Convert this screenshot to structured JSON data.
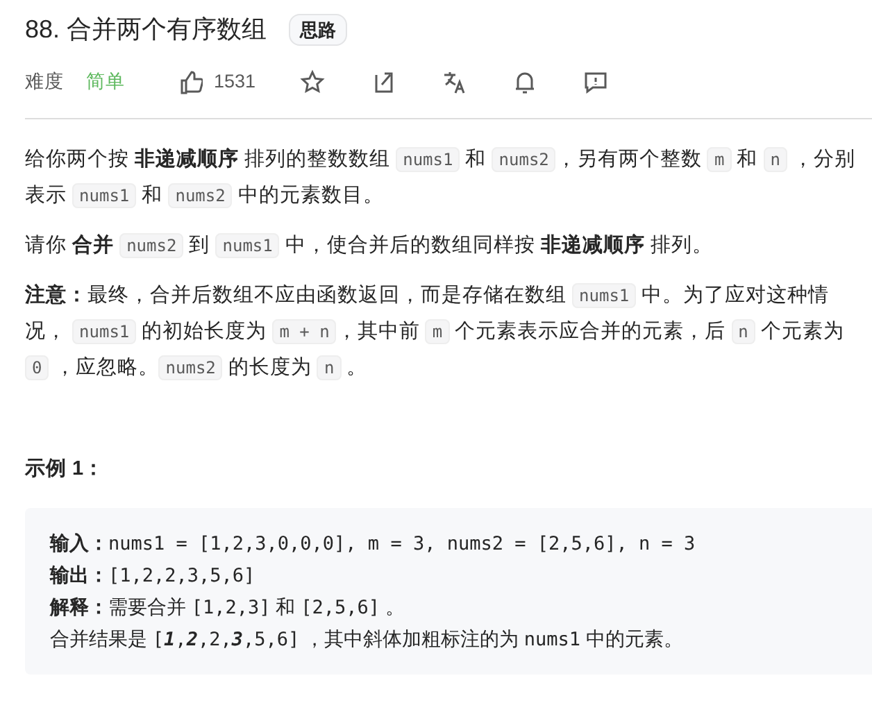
{
  "title": "88. 合并两个有序数组",
  "tag": "思路",
  "meta": {
    "difficulty_label": "难度",
    "difficulty": "简单",
    "likes": "1531"
  },
  "paragraphs": [
    [
      {
        "kind": "text",
        "text": "给你两个按 **非递减顺序** 排列的整数数组 "
      },
      {
        "kind": "code",
        "text": "nums1"
      },
      {
        "kind": "text",
        "text": " 和 "
      },
      {
        "kind": "code",
        "text": "nums2"
      },
      {
        "kind": "text",
        "text": "，另有两个整数 "
      },
      {
        "kind": "code",
        "text": "m"
      },
      {
        "kind": "text",
        "text": " 和 "
      },
      {
        "kind": "code",
        "text": "n"
      },
      {
        "kind": "text",
        "text": " ，分别表示 "
      },
      {
        "kind": "code",
        "text": "nums1"
      },
      {
        "kind": "text",
        "text": " 和 "
      },
      {
        "kind": "code",
        "text": "nums2"
      },
      {
        "kind": "text",
        "text": " 中的元素数目。"
      }
    ],
    [
      {
        "kind": "text",
        "text": "请你 **合并** "
      },
      {
        "kind": "code",
        "text": "nums2"
      },
      {
        "kind": "text",
        "text": " 到 "
      },
      {
        "kind": "code",
        "text": "nums1"
      },
      {
        "kind": "text",
        "text": " 中，使合并后的数组同样按 **非递减顺序** 排列。"
      }
    ],
    [
      {
        "kind": "text",
        "text": "**注意：**最终，合并后数组不应由函数返回，而是存储在数组 "
      },
      {
        "kind": "code",
        "text": "nums1"
      },
      {
        "kind": "text",
        "text": " 中。为了应对这种情况， "
      },
      {
        "kind": "code",
        "text": "nums1"
      },
      {
        "kind": "text",
        "text": " 的初始长度为 "
      },
      {
        "kind": "code",
        "text": "m + n"
      },
      {
        "kind": "text",
        "text": "，其中前 "
      },
      {
        "kind": "code",
        "text": "m"
      },
      {
        "kind": "text",
        "text": " 个元素表示应合并的元素，后 "
      },
      {
        "kind": "code",
        "text": "n"
      },
      {
        "kind": "text",
        "text": " 个元素为 "
      },
      {
        "kind": "code",
        "text": "0"
      },
      {
        "kind": "text",
        "text": " ，应忽略。"
      },
      {
        "kind": "code",
        "text": "nums2"
      },
      {
        "kind": "text",
        "text": " 的长度为 "
      },
      {
        "kind": "code",
        "text": "n"
      },
      {
        "kind": "text",
        "text": " 。"
      }
    ]
  ],
  "example": {
    "heading": "示例 1：",
    "lines": [
      [
        {
          "kind": "label",
          "text": "输入："
        },
        {
          "kind": "mono",
          "text": "nums1 = [1,2,3,0,0,0], m = 3, nums2 = [2,5,6], n = 3"
        }
      ],
      [
        {
          "kind": "label",
          "text": "输出："
        },
        {
          "kind": "mono",
          "text": "[1,2,2,3,5,6]"
        }
      ],
      [
        {
          "kind": "label",
          "text": "解释："
        },
        {
          "kind": "text",
          "text": "需要合并 "
        },
        {
          "kind": "mono",
          "text": "[1,2,3]"
        },
        {
          "kind": "text",
          "text": " 和 "
        },
        {
          "kind": "mono",
          "text": "[2,5,6]"
        },
        {
          "kind": "text",
          "text": " 。"
        }
      ],
      [
        {
          "kind": "text",
          "text": "合并结果是 "
        },
        {
          "kind": "mono",
          "text": "["
        },
        {
          "kind": "emph",
          "text": "1"
        },
        {
          "kind": "mono",
          "text": ","
        },
        {
          "kind": "emph",
          "text": "2"
        },
        {
          "kind": "mono",
          "text": ",2,"
        },
        {
          "kind": "emph",
          "text": "3"
        },
        {
          "kind": "mono",
          "text": ",5,6]"
        },
        {
          "kind": "text",
          "text": " ，其中斜体加粗标注的为 "
        },
        {
          "kind": "mono",
          "text": "nums1"
        },
        {
          "kind": "text",
          "text": " 中的元素。"
        }
      ]
    ]
  }
}
